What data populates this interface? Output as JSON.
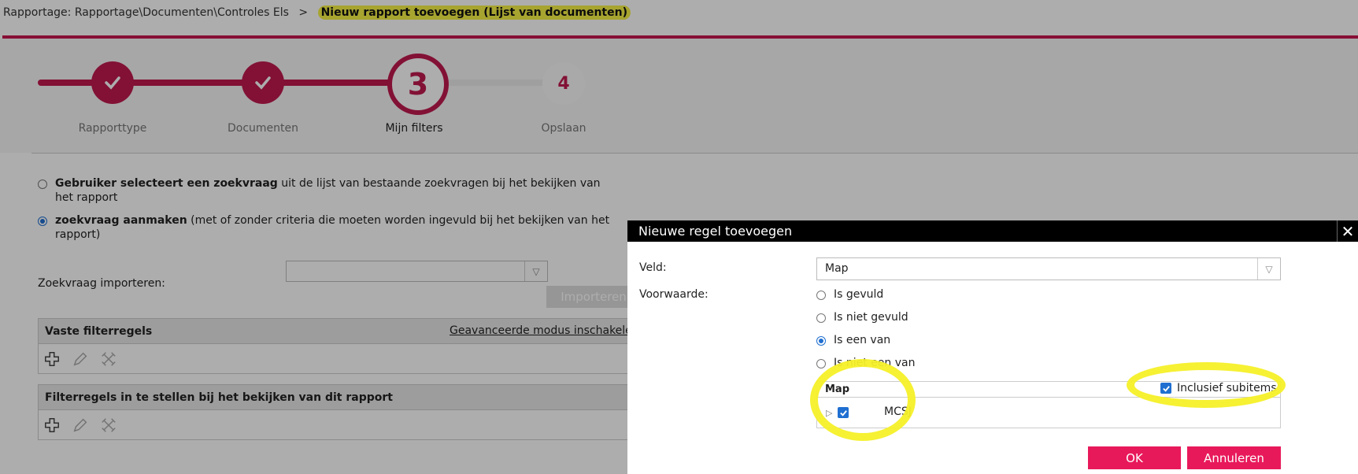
{
  "breadcrumb": {
    "path": "Rapportage: Rapportage\\Documenten\\Controles Els",
    "separator": ">",
    "current": "Nieuw rapport toevoegen (Lijst van documenten)"
  },
  "wizard": {
    "steps": [
      {
        "label": "Rapporttype",
        "state": "done"
      },
      {
        "label": "Documenten",
        "state": "done"
      },
      {
        "label": "Mijn filters",
        "number": "3",
        "state": "active"
      },
      {
        "label": "Opslaan",
        "number": "4",
        "state": "todo"
      }
    ]
  },
  "query_options": {
    "option1_bold": "Gebruiker selecteert een zoekvraag",
    "option1_rest": " uit de lijst van bestaande zoekvragen bij het bekijken van het rapport",
    "option2_bold": "zoekvraag aanmaken",
    "option2_rest": " (met of zonder criteria die moeten worden ingevuld bij het bekijken van het rapport)",
    "selected": 2
  },
  "import": {
    "label": "Zoekvraag importeren:",
    "value": "",
    "button": "Importeren"
  },
  "fixed_filters": {
    "title": "Vaste filterregels",
    "advanced_link": "Geavanceerde modus inschakelen"
  },
  "view_filters": {
    "title": "Filterregels in te stellen bij het bekijken van dit rapport"
  },
  "dialog": {
    "title": "Nieuwe regel toevoegen",
    "close": "✕",
    "field_label": "Veld:",
    "field_value": "Map",
    "condition_label": "Voorwaarde:",
    "conditions": [
      "Is gevuld",
      "Is niet gevuld",
      "Is een van",
      "Is niet een van"
    ],
    "selected_condition": 2,
    "tree": {
      "header": "Map",
      "include_subitems_label": "Inclusief subitems",
      "include_subitems": true,
      "items": [
        {
          "name": "MCSJ",
          "checked": true
        }
      ]
    },
    "ok": "OK",
    "cancel": "Annuleren"
  },
  "colors": {
    "brand": "#c01a4f",
    "button": "#e8195b",
    "accent_blue": "#1f6fd1",
    "highlight": "#f6f028"
  }
}
